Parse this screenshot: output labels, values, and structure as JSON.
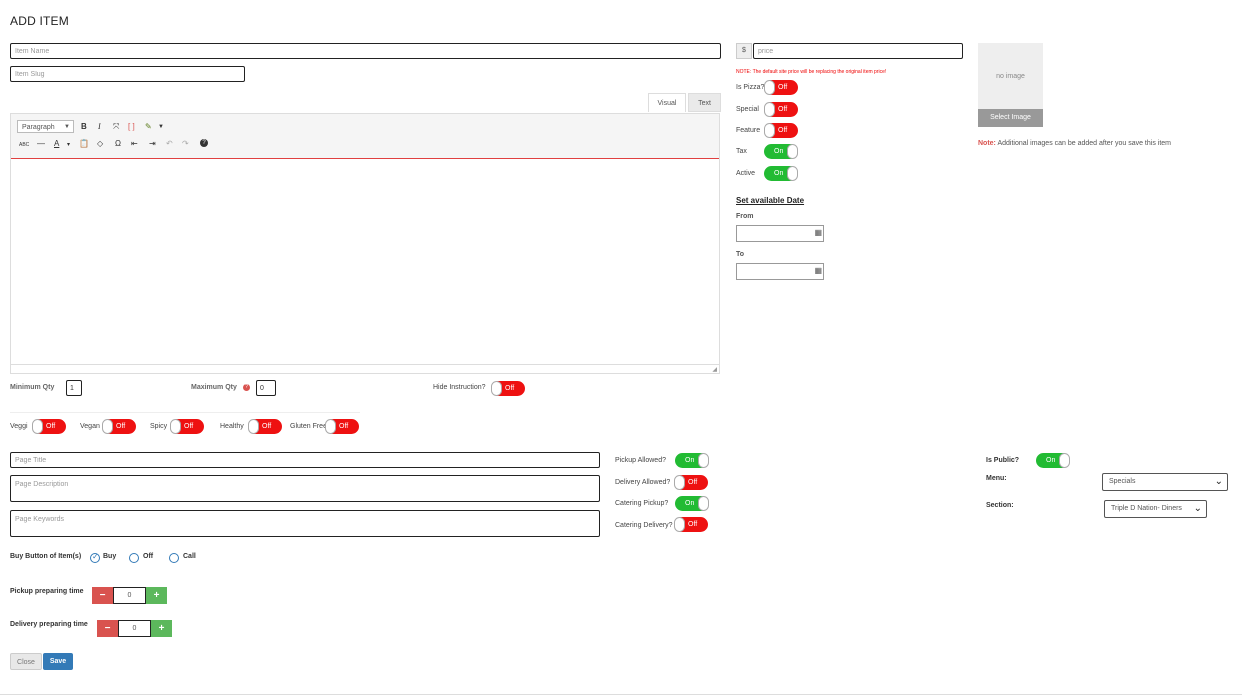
{
  "page": {
    "title": "ADD ITEM"
  },
  "item": {
    "name_placeholder": "Item Name",
    "slug_placeholder": "Item Slug",
    "price_prefix": "$",
    "price_placeholder": "price",
    "price_note": "NOTE: The default site price will be replacing the original item price!"
  },
  "editor": {
    "tab_visual": "Visual",
    "tab_text": "Text",
    "format_select": "Paragraph",
    "toolbar_row1": [
      "B",
      "I",
      "⤧",
      "[ ]",
      "✎"
    ],
    "toolbar_row2": [
      "ABC",
      "—",
      "A",
      "▾",
      "📋",
      "◇",
      "Ω",
      "⇤",
      "⇥",
      "↶",
      "↷",
      "?"
    ]
  },
  "qty": {
    "min_label": "Minimum Qty",
    "min_value": "1",
    "max_label": "Maximum Qty",
    "max_value": "0",
    "hide_instruction_label": "Hide Instruction?",
    "hide_instruction_state": "Off"
  },
  "diet": [
    {
      "label": "Veggi",
      "state": "Off"
    },
    {
      "label": "Vegan",
      "state": "Off"
    },
    {
      "label": "Spicy",
      "state": "Off"
    },
    {
      "label": "Healthy",
      "state": "Off"
    },
    {
      "label": "Gluten Free",
      "state": "Off"
    }
  ],
  "flags": [
    {
      "label": "Is Pizza?",
      "state": "Off"
    },
    {
      "label": "Special",
      "state": "Off"
    },
    {
      "label": "Feature",
      "state": "Off"
    },
    {
      "label": "Tax",
      "state": "On"
    },
    {
      "label": "Active",
      "state": "On"
    }
  ],
  "dates": {
    "heading": "Set available Date",
    "from_label": "From",
    "to_label": "To"
  },
  "image": {
    "no_image": "no image",
    "select_button": "Select Image",
    "note_prefix": "Note:",
    "note_text": " Additional images can be added after you save this item"
  },
  "seo": {
    "title_placeholder": "Page Title",
    "description_placeholder": "Page Description",
    "keywords_placeholder": "Page Keywords"
  },
  "service": [
    {
      "label": "Pickup Allowed?",
      "state": "On"
    },
    {
      "label": "Delivery Allowed?",
      "state": "Off"
    },
    {
      "label": "Catering Pickup?",
      "state": "On"
    },
    {
      "label": "Catering Delivery?",
      "state": "Off"
    }
  ],
  "visibility": {
    "is_public_label": "Is Public?",
    "is_public_state": "On",
    "menu_label": "Menu:",
    "menu_value": "Specials",
    "section_label": "Section:",
    "section_value": "Triple D Nation- Diners"
  },
  "buy_button": {
    "label": "Buy Button of Item(s)",
    "options": [
      "Buy",
      "Off",
      "Call"
    ],
    "selected": "Buy"
  },
  "prep": {
    "pickup_label": "Pickup preparing time",
    "pickup_value": "0",
    "delivery_label": "Delivery preparing time",
    "delivery_value": "0"
  },
  "actions": {
    "close": "Close",
    "save": "Save"
  }
}
